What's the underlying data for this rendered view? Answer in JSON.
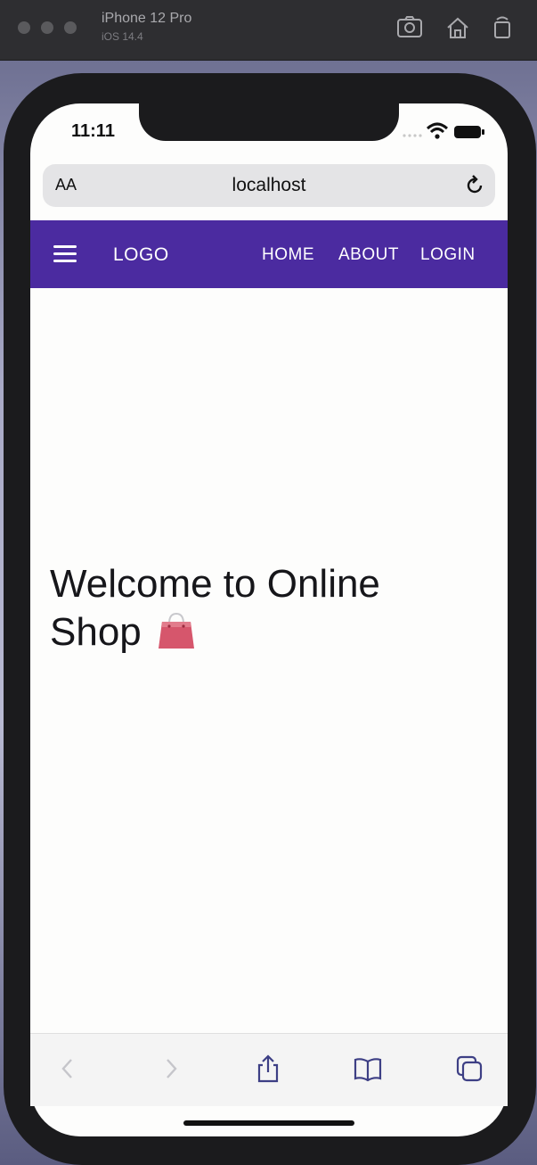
{
  "simulator": {
    "device_name": "iPhone 12 Pro",
    "os_version": "iOS 14.4"
  },
  "status_bar": {
    "time": "11:11"
  },
  "browser": {
    "text_size_label": "AA",
    "url": "localhost"
  },
  "navbar": {
    "logo": "LOGO",
    "links": [
      "HOME",
      "ABOUT",
      "LOGIN"
    ],
    "background": "#4b2ba0"
  },
  "hero": {
    "title": "Welcome to Online Shop",
    "icon": "shopping-bag-icon"
  },
  "toolbar": {
    "icons": [
      "back-icon",
      "forward-icon",
      "share-icon",
      "bookmarks-icon",
      "tabs-icon"
    ]
  }
}
